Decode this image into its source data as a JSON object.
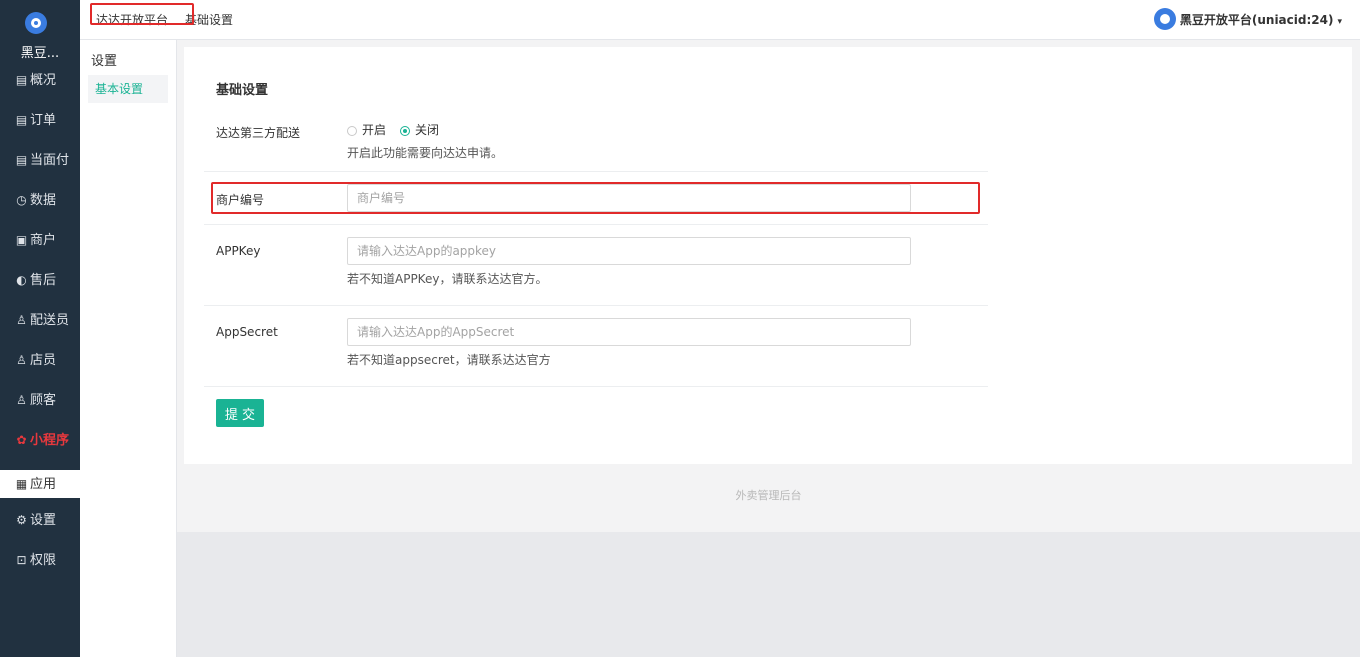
{
  "sidebar": {
    "brand": "黑豆...",
    "logo_icon": "bean-logo-icon",
    "items": [
      {
        "icon": "▤",
        "label": "概况"
      },
      {
        "icon": "▤",
        "label": "订单"
      },
      {
        "icon": "▤",
        "label": "当面付"
      },
      {
        "icon": "◷",
        "label": "数据"
      },
      {
        "icon": "▣",
        "label": "商户"
      },
      {
        "icon": "◐",
        "label": "售后"
      },
      {
        "icon": "♙",
        "label": "配送员"
      },
      {
        "icon": "♙",
        "label": "店员"
      },
      {
        "icon": "♙",
        "label": "顾客"
      },
      {
        "icon": "✿",
        "label": "小程序"
      },
      {
        "icon": "▦",
        "label": "应用"
      },
      {
        "icon": "⚙",
        "label": "设置"
      },
      {
        "icon": "⊡",
        "label": "权限"
      }
    ],
    "active_item": "应用",
    "highlight_item": "小程序"
  },
  "subnav": {
    "title": "设置",
    "items": [
      {
        "label": "基本设置"
      }
    ]
  },
  "header": {
    "breadcrumb": [
      "达达开放平台",
      "基础设置"
    ],
    "user_name": "黑豆开放平台(uniacid:24)",
    "caret": "▾"
  },
  "form": {
    "section_title": "基础设置",
    "dada": {
      "label": "达达第三方配送",
      "options": [
        "开启",
        "关闭"
      ],
      "selected": "关闭",
      "help": "开启此功能需要向达达申请。"
    },
    "merchant_id": {
      "label": "商户编号",
      "value": "",
      "placeholder": "商户编号"
    },
    "app_key": {
      "label": "APPKey",
      "value": "",
      "placeholder": "请输入达达App的appkey",
      "help": "若不知道APPKey，请联系达达官方。"
    },
    "app_secret": {
      "label": "AppSecret",
      "value": "",
      "placeholder": "请输入达达App的AppSecret",
      "help": "若不知道appsecret，请联系达达官方"
    },
    "submit_label": "提 交"
  },
  "footer": {
    "text": "外卖管理后台"
  },
  "colors": {
    "sidebar_bg": "#213140",
    "accent": "#1ab394",
    "annotation": "#e12a2a",
    "danger": "#e8383d"
  }
}
